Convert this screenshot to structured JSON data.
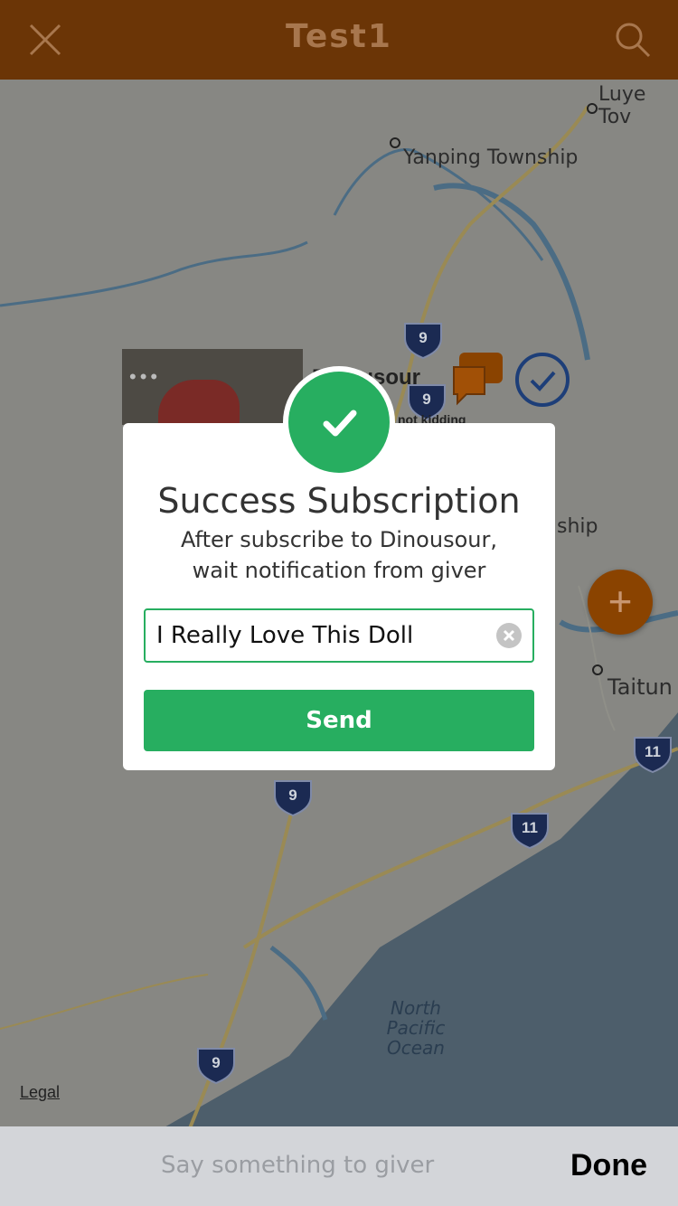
{
  "topbar": {
    "title": "Test1",
    "close_icon": "close-icon",
    "search_icon": "search-icon"
  },
  "map": {
    "labels": {
      "luye": "Luye Tov",
      "yanping": "Yanping Township",
      "ship": "ship",
      "taitung": "Taitun"
    },
    "ocean": {
      "line1": "North",
      "line2": "Pacific",
      "line3": "Ocean"
    },
    "legal": "Legal",
    "highway_labels": [
      "9",
      "9",
      "9",
      "9",
      "11",
      "11"
    ],
    "pin": {
      "name": "Dinousour",
      "note": "not kidding"
    }
  },
  "modal": {
    "title": "Success Subscription",
    "message_line1": "After subscribe to Dinousour,",
    "message_line2": "wait notification from giver",
    "input_value": "I Really Love This Doll",
    "send_label": "Send",
    "accent_color": "#27ae60"
  },
  "bottombar": {
    "placeholder": "Say something to giver",
    "done_label": "Done"
  }
}
